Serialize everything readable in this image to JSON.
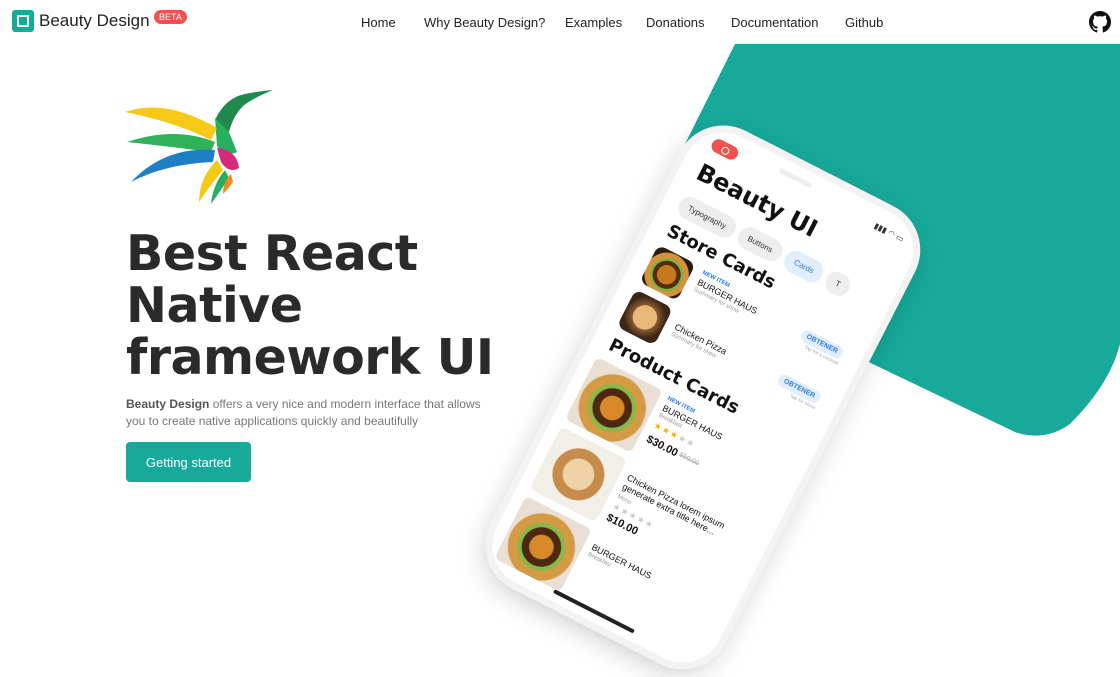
{
  "brand": {
    "name": "Beauty Design",
    "badge": "BETA"
  },
  "nav": {
    "items": [
      {
        "label": "Home"
      },
      {
        "label": "Why Beauty Design?"
      },
      {
        "label": "Examples"
      },
      {
        "label": "Donations"
      },
      {
        "label": "Documentation"
      },
      {
        "label": "Github"
      }
    ],
    "github_icon": "github-icon"
  },
  "hero": {
    "headline": [
      "Best React",
      "Native",
      "framework UI"
    ],
    "description_brand": "Beauty Design",
    "description_rest": " offers a very nice and modern interface that allows you to create native applications quickly and beautifully",
    "cta_label": "Getting started"
  },
  "colors": {
    "accent": "#17a99a",
    "badge": "#f0524f",
    "text": "#2a2a2a",
    "link": "#2d7ce0"
  },
  "phone": {
    "app_title": "Beauty UI",
    "chips": [
      {
        "label": "Typography"
      },
      {
        "label": "Buttons"
      },
      {
        "label": "Cards"
      },
      {
        "label": "T"
      }
    ],
    "store_section": "Store Cards",
    "store_items": [
      {
        "tag": "NEW ITEM",
        "name": "BURGER HAUS",
        "sub": "Summary for show",
        "action": "OBTENER",
        "action_sub": "Tap for a cocktail"
      },
      {
        "tag": "",
        "name": "Chicken Pizza",
        "sub": "Summary for show",
        "action": "OBTENER",
        "action_sub": "Tap for show"
      }
    ],
    "product_section": "Product Cards",
    "product_items": [
      {
        "tag": "NEW ITEM",
        "name": "BURGER HAUS",
        "sub": "Breakfast",
        "price": "$30.00",
        "old_price": "$50.00",
        "rating": 3
      },
      {
        "tag": "",
        "name": "Chicken Pizza lorem ipsum generate extra title here...",
        "sub": "Menu",
        "price": "$10.00",
        "old_price": "",
        "rating": 0
      },
      {
        "tag": "",
        "name": "BURGER HAUS",
        "sub": "Breakfast",
        "price": "",
        "old_price": "",
        "rating": 0
      }
    ]
  }
}
